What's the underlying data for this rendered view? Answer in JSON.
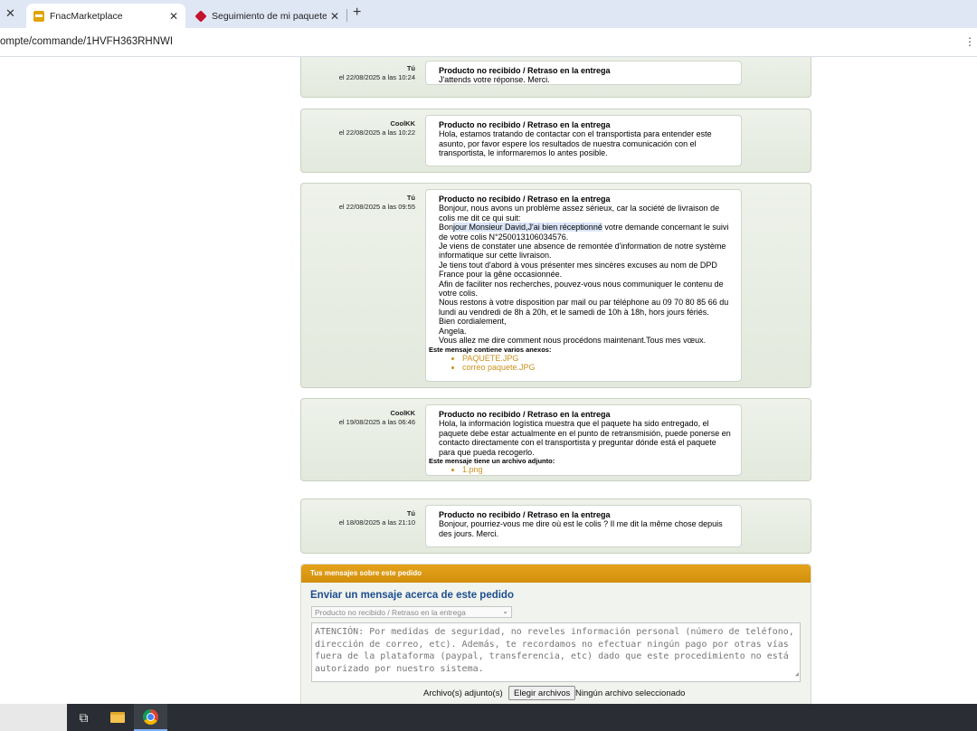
{
  "browser": {
    "tabs": [
      {
        "title": "FnacMarketplace",
        "active": true,
        "icon": "fnac-favicon-icon"
      },
      {
        "title": "Seguimiento de mi paquete | DPD",
        "active": false,
        "icon": "dpd-favicon-icon"
      }
    ],
    "url": "ompte/commande/1HVFH363RHNWI",
    "glyphs": {
      "close": "✕",
      "new_tab": "+",
      "more": "⋮"
    }
  },
  "messages": [
    {
      "author": "Tú",
      "date": "el 22/08/2025 a las 10:24",
      "subject": "Producto no recibido / Retraso en la entrega",
      "body": [
        "J'attends votre réponse. Merci."
      ]
    },
    {
      "author": "CoolKK",
      "date": "el 22/08/2025 a las 10:22",
      "subject": "Producto no recibido / Retraso en la entrega",
      "body": [
        "Hola, estamos tratando de contactar con el transportista para entender este asunto, por favor espere los resultados de nuestra comunicación con el transportista, le informaremos lo antes posible."
      ]
    },
    {
      "author": "Tú",
      "date": "el 22/08/2025 a las 09:55",
      "subject": "Producto no recibido / Retraso en la entrega",
      "body": [
        "Bonjour, nous avons un problème assez sérieux, car la société de livraison de colis me dit ce qui suit:",
        "Bonjour Monsieur David,J'ai bien réceptionné votre demande concernant le suivi de votre colis N°250013106034576.",
        "Je viens de constater une absence de remontée d'information de notre système informatique sur cette livraison.",
        "Je tiens tout d'abord à vous présenter mes sincères excuses au nom de DPD France pour la gêne occasionnée.",
        "Afin de faciliter nos recherches, pouvez-vous nous communiquer le contenu de votre colis.",
        "Nous restons à votre disposition par mail ou par téléphone au 09 70 80 85 66 du lundi au vendredi de 8h à 20h, et le samedi de 10h à 18h, hors jours fériés.",
        "Bien cordialement,",
        "Angela.",
        "Vous allez me dire comment nous procédons maintenant.Tous mes vœux."
      ],
      "attachments_label": "Este mensaje contiene varios anexos:",
      "attachments": [
        "PAQUETE.JPG",
        "correo paquete.JPG"
      ]
    },
    {
      "author": "CoolKK",
      "date": "el 19/08/2025 a las 06:46",
      "subject": "Producto no recibido / Retraso en la entrega",
      "body": [
        "Hola, la información logística muestra que el paquete ha sido entregado, el paquete debe estar actualmente en el punto de retransmisión, puede ponerse en contacto directamente con el transportista y preguntar dónde está el paquete para que pueda recogerlo."
      ],
      "attachments_label": "Este mensaje tiene un archivo adjunto:",
      "attachments": [
        "1.png"
      ]
    },
    {
      "author": "Tú",
      "date": "el 18/08/2025 a las 21:10",
      "subject": "Producto no recibido / Retraso en la entrega",
      "body": [
        "Bonjour, pourriez-vous me dire où est le colis ? Il me dit la même chose depuis des jours. Merci."
      ]
    }
  ],
  "compose": {
    "header": "Tus mensajes sobre este pedido",
    "title": "Enviar un mensaje acerca de este pedido",
    "subject_selected": "Producto no recibido / Retraso en la entrega",
    "select_chevron": "⌄",
    "placeholder": "ATENCIÓN: Por medidas de seguridad, no reveles información personal (número de teléfono, dirección de correo, etc). Además, te recordamos no efectuar ningún pago por otras vías fuera de la plataforma (paypal, transferencia, etc) dado que este procedimiento no está autorizado por nuestro sistema.",
    "attachments_label": "Archivo(s) adjunto(s)",
    "choose_files": "Elegir archivos",
    "no_file": "Ningún archivo seleccionado"
  },
  "taskbar": {
    "icons": [
      "task-view-icon",
      "file-explorer-icon",
      "chrome-icon"
    ],
    "task_view_glyph": "⧉"
  }
}
